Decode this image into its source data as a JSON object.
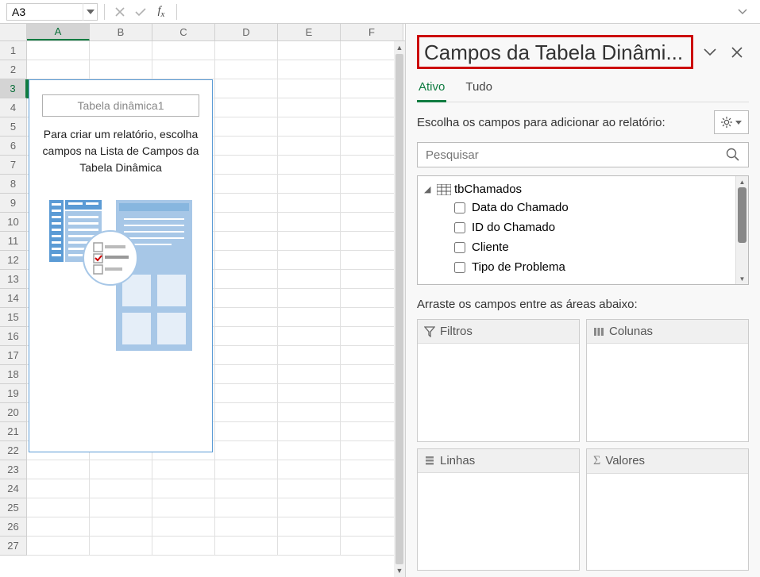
{
  "namebox": "A3",
  "formula": "",
  "columns": [
    "A",
    "B",
    "C",
    "D",
    "E",
    "F"
  ],
  "selected_column_index": 0,
  "rows_count": 27,
  "selected_row": 3,
  "pivot_placeholder": {
    "title": "Tabela dinâmica1",
    "message": "Para criar um relatório, escolha campos na Lista de Campos da Tabela Dinâmica"
  },
  "side_panel": {
    "title": "Campos da Tabela Dinâmi...",
    "tabs": {
      "active": "Ativo",
      "all": "Tudo"
    },
    "choose_label": "Escolha os campos para adicionar ao relatório:",
    "search_placeholder": "Pesquisar",
    "table_name": "tbChamados",
    "fields": [
      {
        "label": "Data do Chamado"
      },
      {
        "label": "ID do Chamado"
      },
      {
        "label": "Cliente"
      },
      {
        "label": "Tipo de Problema"
      }
    ],
    "drag_label": "Arraste os campos entre as áreas abaixo:",
    "areas": {
      "filters": "Filtros",
      "columns": "Colunas",
      "rows": "Linhas",
      "values": "Valores"
    }
  }
}
